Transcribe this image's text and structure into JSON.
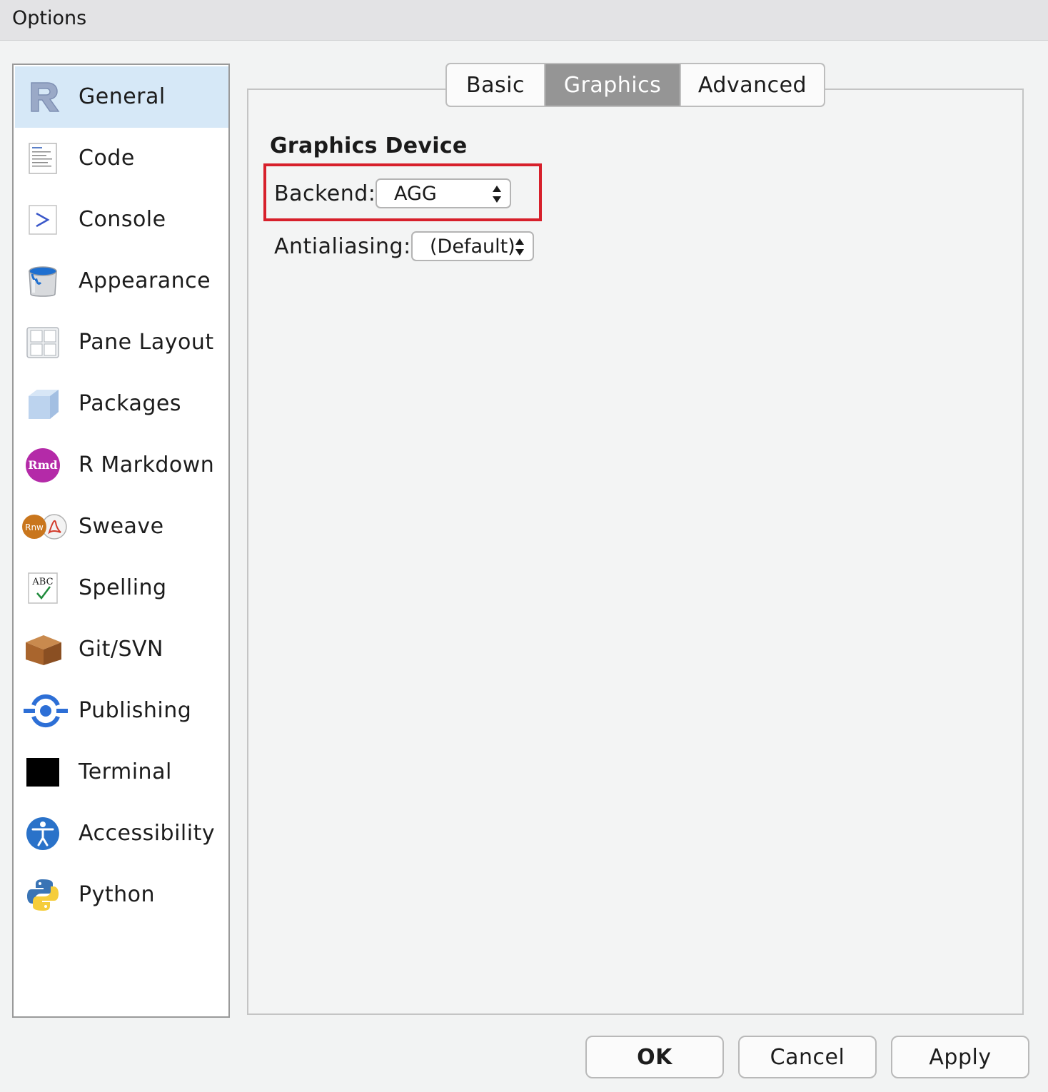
{
  "window": {
    "title": "Options"
  },
  "sidebar": {
    "items": [
      {
        "label": "General",
        "icon": "r-logo-icon",
        "selected": true
      },
      {
        "label": "Code",
        "icon": "code-document-icon"
      },
      {
        "label": "Console",
        "icon": "console-prompt-icon"
      },
      {
        "label": "Appearance",
        "icon": "paint-bucket-icon"
      },
      {
        "label": "Pane Layout",
        "icon": "pane-grid-icon"
      },
      {
        "label": "Packages",
        "icon": "package-cube-icon"
      },
      {
        "label": "R Markdown",
        "icon": "rmd-icon",
        "icon_text": "Rmd"
      },
      {
        "label": "Sweave",
        "icon": "sweave-pdf-icon",
        "icon_text": "Rnw"
      },
      {
        "label": "Spelling",
        "icon": "spelling-abc-check-icon",
        "icon_text": "ABC"
      },
      {
        "label": "Git/SVN",
        "icon": "git-box-icon"
      },
      {
        "label": "Publishing",
        "icon": "publishing-icon"
      },
      {
        "label": "Terminal",
        "icon": "terminal-icon"
      },
      {
        "label": "Accessibility",
        "icon": "accessibility-icon"
      },
      {
        "label": "Python",
        "icon": "python-icon"
      }
    ]
  },
  "tabs": [
    {
      "label": "Basic",
      "active": false
    },
    {
      "label": "Graphics",
      "active": true
    },
    {
      "label": "Advanced",
      "active": false
    }
  ],
  "graphics": {
    "section_title": "Graphics Device",
    "backend_label": "Backend:",
    "backend_value": "AGG",
    "antialiasing_label": "Antialiasing:",
    "antialiasing_value": "(Default)"
  },
  "buttons": {
    "ok": "OK",
    "cancel": "Cancel",
    "apply": "Apply"
  },
  "colors": {
    "selected_sidebar": "#d6e8f7",
    "active_tab": "#959595",
    "highlight_box": "#d7202b"
  }
}
